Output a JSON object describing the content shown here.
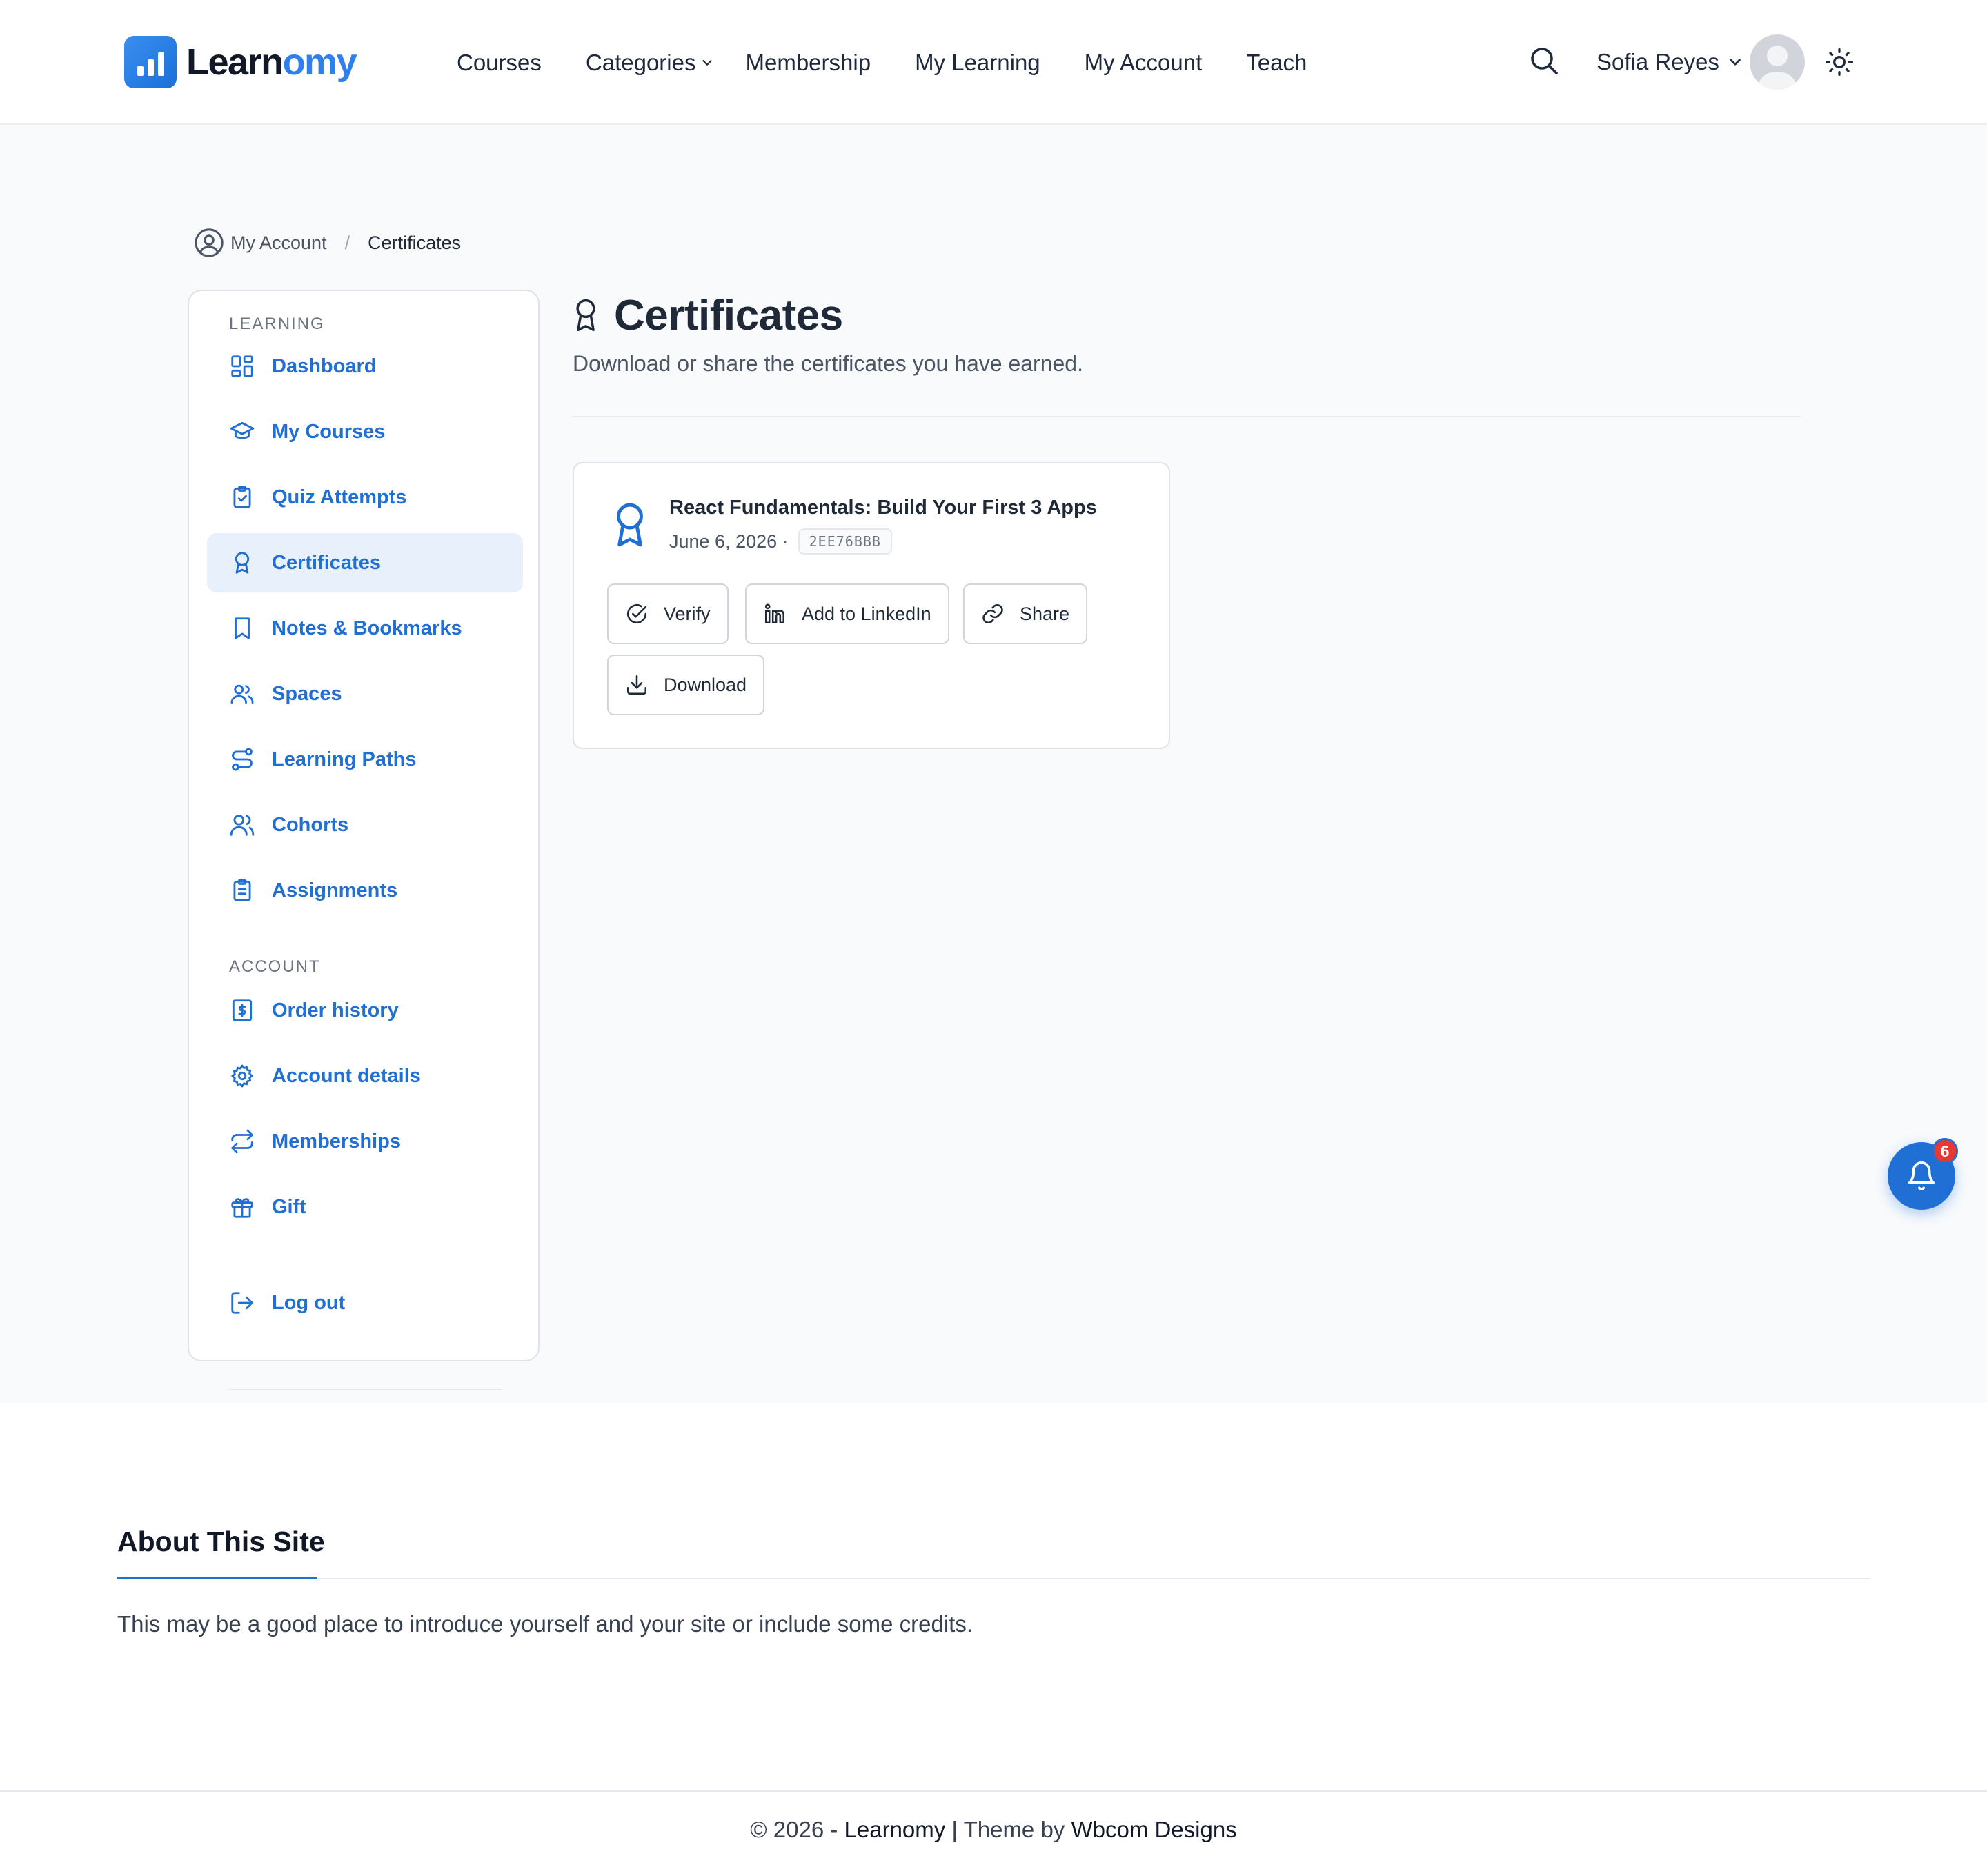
{
  "header": {
    "logo": {
      "prefix": "Learn",
      "accent": "omy"
    },
    "nav": [
      {
        "label": "Courses"
      },
      {
        "label": "Categories"
      },
      {
        "label": "Membership"
      },
      {
        "label": "My Learning"
      },
      {
        "label": "My Account"
      },
      {
        "label": "Teach"
      }
    ],
    "user_name": "Sofia Reyes"
  },
  "breadcrumb": {
    "home": "My Account",
    "separator": "/",
    "current": "Certificates"
  },
  "sidebar": {
    "learning_title": "LEARNING",
    "learning_items": [
      {
        "label": "Dashboard",
        "icon": "dashboard-icon"
      },
      {
        "label": "My Courses",
        "icon": "graduation-cap-icon"
      },
      {
        "label": "Quiz Attempts",
        "icon": "clipboard-check-icon"
      },
      {
        "label": "Certificates",
        "icon": "award-icon",
        "active": true
      },
      {
        "label": "Notes & Bookmarks",
        "icon": "bookmark-icon"
      },
      {
        "label": "Spaces",
        "icon": "users-icon"
      },
      {
        "label": "Learning Paths",
        "icon": "route-icon"
      },
      {
        "label": "Cohorts",
        "icon": "user-group-icon"
      },
      {
        "label": "Assignments",
        "icon": "clipboard-list-icon"
      }
    ],
    "account_title": "ACCOUNT",
    "account_items": [
      {
        "label": "Order history",
        "icon": "receipt-icon"
      },
      {
        "label": "Account details",
        "icon": "gear-icon"
      },
      {
        "label": "Memberships",
        "icon": "repeat-icon"
      },
      {
        "label": "Gift",
        "icon": "gift-icon"
      }
    ],
    "logout_label": "Log out"
  },
  "main": {
    "title": "Certificates",
    "subtitle": "Download or share the certificates you have earned.",
    "certificates": [
      {
        "course": "React Fundamentals: Build Your First 3 Apps",
        "date": "June 6, 2026 ·",
        "code": "2EE76BBB",
        "actions": {
          "verify": "Verify",
          "linkedin": "Add to LinkedIn",
          "share": "Share",
          "download": "Download"
        }
      }
    ]
  },
  "notifications": {
    "count": "6"
  },
  "about": {
    "title": "About This Site",
    "text": "This may be a good place to introduce yourself and your site or include some credits."
  },
  "footer": {
    "prefix": "© 2026 - ",
    "site": "Learnomy",
    "middle": " | Theme by ",
    "author": "Wbcom Designs"
  },
  "colors": {
    "accent": "#1f6fd4",
    "active_bg": "#e7f0fb",
    "badge": "#e53935",
    "page_bg": "#f8fafc"
  }
}
